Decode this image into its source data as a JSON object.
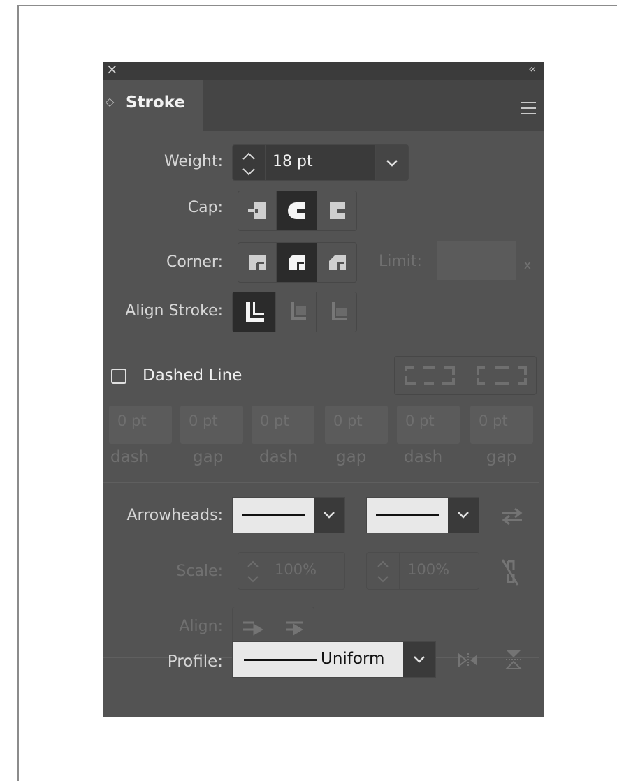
{
  "panel": {
    "close_glyph": "×",
    "collapse_glyph": "‹‹",
    "tab_arrow": "◇",
    "title": "Stroke"
  },
  "weight": {
    "label": "Weight:",
    "value": "18 pt"
  },
  "cap": {
    "label": "Cap:",
    "selected": "round-cap"
  },
  "corner": {
    "label": "Corner:",
    "selected": "round-join",
    "limit_label": "Limit:",
    "limit_value": "",
    "limit_unit": "x"
  },
  "align_stroke": {
    "label": "Align Stroke:",
    "selected": "center"
  },
  "dashed": {
    "label": "Dashed Line",
    "checked": false,
    "fields": [
      {
        "value": "0 pt",
        "label": "dash"
      },
      {
        "value": "0 pt",
        "label": "gap"
      },
      {
        "value": "0 pt",
        "label": "dash"
      },
      {
        "value": "0 pt",
        "label": "gap"
      },
      {
        "value": "0 pt",
        "label": "dash"
      },
      {
        "value": "0 pt",
        "label": "gap"
      }
    ]
  },
  "arrowheads": {
    "label": "Arrowheads:",
    "start": "None",
    "end": "None"
  },
  "scale": {
    "label": "Scale:",
    "start": "100%",
    "end": "100%"
  },
  "align": {
    "label": "Align:"
  },
  "profile": {
    "label": "Profile:",
    "value": "Uniform"
  },
  "colors": {
    "panel_bg": "#535353",
    "tab_bg": "#454545",
    "selected_bg": "#2b2b2b",
    "text": "#d6d6d6"
  }
}
